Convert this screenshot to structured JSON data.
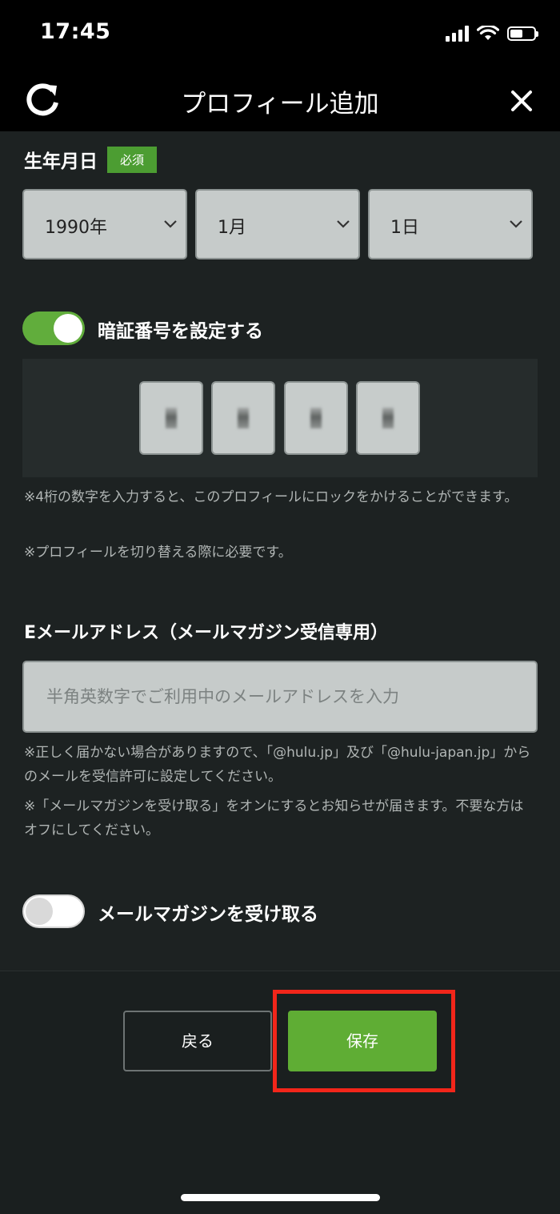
{
  "status_bar": {
    "time": "17:45"
  },
  "nav": {
    "title": "プロフィール追加"
  },
  "birthday": {
    "label": "生年月日",
    "required_badge": "必須",
    "year": "1990年",
    "month": "1月",
    "day": "1日"
  },
  "pin": {
    "toggle_label": "暗証番号を設定する",
    "toggle_on": true,
    "note1": "※4桁の数字を入力すると、このプロフィールにロックをかけることができます。",
    "note2": "※プロフィールを切り替える際に必要です。"
  },
  "email": {
    "label": "Eメールアドレス（メールマガジン受信専用）",
    "placeholder": "半角英数字でご利用中のメールアドレスを入力",
    "note1": "※正しく届かない場合がありますので、「@hulu.jp」及び「@hulu-japan.jp」からのメールを受信許可に設定してください。",
    "note2": "※「メールマガジンを受け取る」をオンにするとお知らせが届きます。不要な方はオフにしてください。"
  },
  "newsletter": {
    "toggle_label": "メールマガジンを受け取る",
    "toggle_on": false
  },
  "buttons": {
    "back": "戻る",
    "save": "保存"
  },
  "colors": {
    "accent_green": "#5fad34",
    "highlight_red": "#f2261a",
    "background": "#1d2222"
  },
  "icons": [
    "refresh-icon",
    "close-icon",
    "chevron-down-icon"
  ]
}
